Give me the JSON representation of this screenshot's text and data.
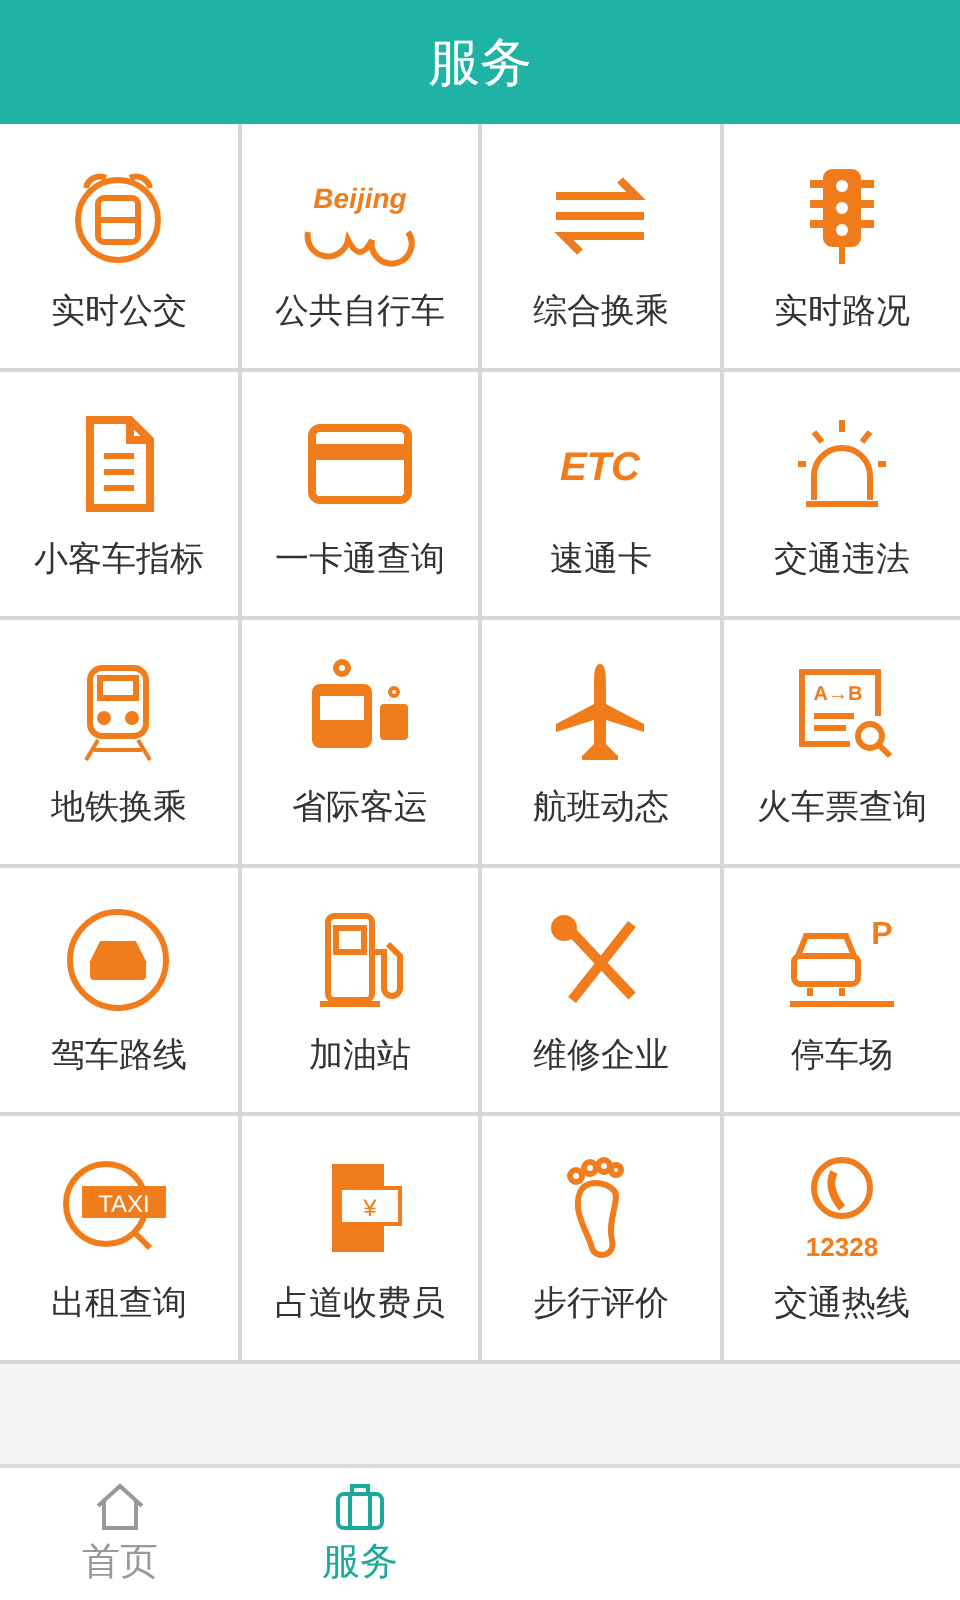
{
  "header": {
    "title": "服务"
  },
  "services": [
    {
      "label": "实时公交",
      "kind": "alarm-bus"
    },
    {
      "label": "公共自行车",
      "kind": "bike",
      "icon_text": "Beijing"
    },
    {
      "label": "综合换乘",
      "kind": "transfer"
    },
    {
      "label": "实时路况",
      "kind": "traffic-light"
    },
    {
      "label": "小客车指标",
      "kind": "document"
    },
    {
      "label": "一卡通查询",
      "kind": "card"
    },
    {
      "label": "速通卡",
      "kind": "etc",
      "icon_text": "ETC"
    },
    {
      "label": "交通违法",
      "kind": "siren"
    },
    {
      "label": "地铁换乘",
      "kind": "train"
    },
    {
      "label": "省际客运",
      "kind": "coach"
    },
    {
      "label": "航班动态",
      "kind": "plane"
    },
    {
      "label": "火车票查询",
      "kind": "ticket",
      "icon_text": "A→B"
    },
    {
      "label": "驾车路线",
      "kind": "car-circle"
    },
    {
      "label": "加油站",
      "kind": "fuel"
    },
    {
      "label": "维修企业",
      "kind": "tools"
    },
    {
      "label": "停车场",
      "kind": "parking",
      "icon_text": "P"
    },
    {
      "label": "出租查询",
      "kind": "taxi",
      "icon_text": "TAXI"
    },
    {
      "label": "占道收费员",
      "kind": "cash-hand",
      "icon_text": "¥"
    },
    {
      "label": "步行评价",
      "kind": "foot"
    },
    {
      "label": "交通热线",
      "kind": "phone",
      "icon_text": "12328"
    }
  ],
  "tabs": [
    {
      "label": "首页",
      "kind": "home",
      "selected": false
    },
    {
      "label": "服务",
      "kind": "bag",
      "selected": true
    }
  ]
}
